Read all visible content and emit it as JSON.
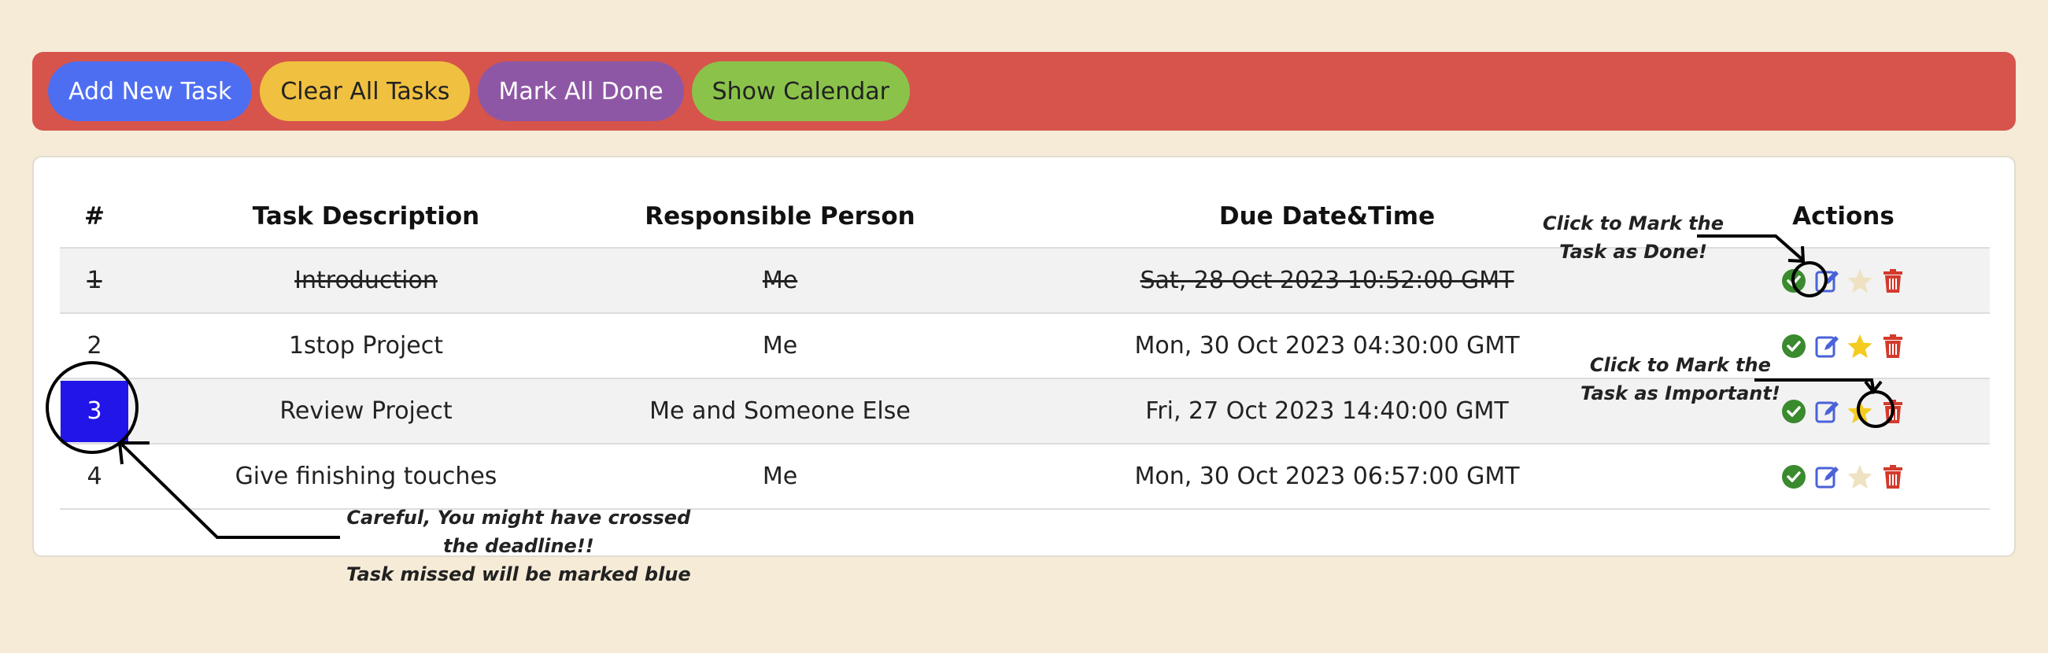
{
  "toolbar": {
    "add_label": "Add New Task",
    "clear_label": "Clear All Tasks",
    "mark_all_label": "Mark All Done",
    "calendar_label": "Show Calendar"
  },
  "table": {
    "headers": [
      "#",
      "Task Description",
      "Responsible Person",
      "Due Date&Time",
      "Actions"
    ],
    "rows": [
      {
        "num": "1",
        "desc": "Introduction",
        "person": "Me",
        "due": "Sat, 28 Oct 2023 10:52:00 GMT",
        "done": true,
        "important": false,
        "missed": false
      },
      {
        "num": "2",
        "desc": "1stop Project",
        "person": "Me",
        "due": "Mon, 30 Oct 2023 04:30:00 GMT",
        "done": false,
        "important": true,
        "missed": false
      },
      {
        "num": "3",
        "desc": "Review Project",
        "person": "Me and Someone Else",
        "due": "Fri, 27 Oct 2023 14:40:00 GMT",
        "done": false,
        "important": true,
        "missed": true
      },
      {
        "num": "4",
        "desc": "Give finishing touches",
        "person": "Me",
        "due": "Mon, 30 Oct 2023 06:57:00 GMT",
        "done": false,
        "important": false,
        "missed": false
      }
    ]
  },
  "annotations": {
    "done_line1": "Click to Mark the",
    "done_line2": "Task as Done!",
    "important_line1": "Click to Mark the",
    "important_line2": "Task as Important!",
    "deadline_line1": "Careful, You might have crossed",
    "deadline_line2": "the deadline!!",
    "deadline_line3": "Task missed will be marked blue"
  },
  "icons": {
    "done": "check-circle-icon",
    "edit": "edit-icon",
    "important": "star-icon",
    "delete": "trash-icon"
  },
  "colors": {
    "toolbar_bg": "#d6544c",
    "add_btn": "#4e6ef2",
    "clear_btn": "#f0c040",
    "mark_all_btn": "#8e57a5",
    "calendar_btn": "#8bc34a",
    "missed_marker": "#2215e8",
    "done_icon": "#3a8a2e",
    "edit_icon": "#4a62d8",
    "star_active": "#f4cc1f",
    "star_inactive": "#efe2c2",
    "delete_icon": "#d33a2c"
  }
}
